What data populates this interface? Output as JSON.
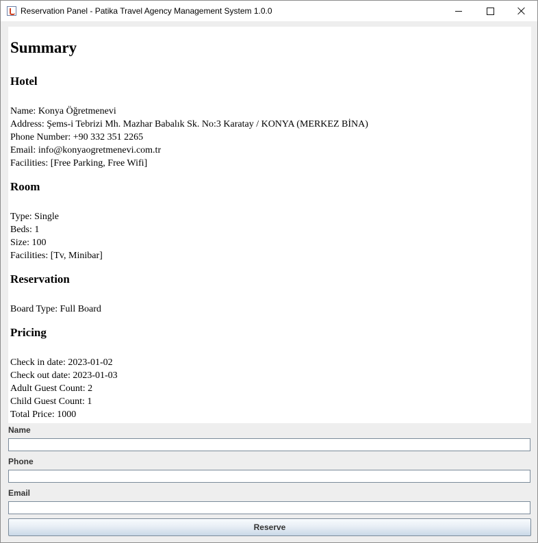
{
  "window": {
    "title": "Reservation Panel - Patika Travel Agency Management System 1.0.0"
  },
  "summary": {
    "heading": "Summary",
    "hotel": {
      "heading": "Hotel",
      "lines": [
        "Name: Konya Öğretmenevi",
        "Address: Şems-i Tebrizi Mh. Mazhar Babalık Sk. No:3 Karatay / KONYA (MERKEZ BİNA)",
        "Phone Number: +90 332 351 2265",
        "Email: info@konyaogretmenevi.com.tr",
        "Facilities: [Free Parking, Free Wifi]"
      ]
    },
    "room": {
      "heading": "Room",
      "lines": [
        "Type: Single",
        "Beds: 1",
        "Size: 100",
        "Facilities: [Tv, Minibar]"
      ]
    },
    "reservation": {
      "heading": "Reservation",
      "lines": [
        "Board Type: Full Board"
      ]
    },
    "pricing": {
      "heading": "Pricing",
      "lines": [
        "Check in date: 2023-01-02",
        "Check out date: 2023-01-03",
        "Adult Guest Count: 2",
        "Child Guest Count: 1",
        "Total Price: 1000"
      ]
    }
  },
  "form": {
    "name_label": "Name",
    "name_value": "",
    "phone_label": "Phone",
    "phone_value": "",
    "email_label": "Email",
    "email_value": "",
    "reserve_label": "Reserve"
  }
}
